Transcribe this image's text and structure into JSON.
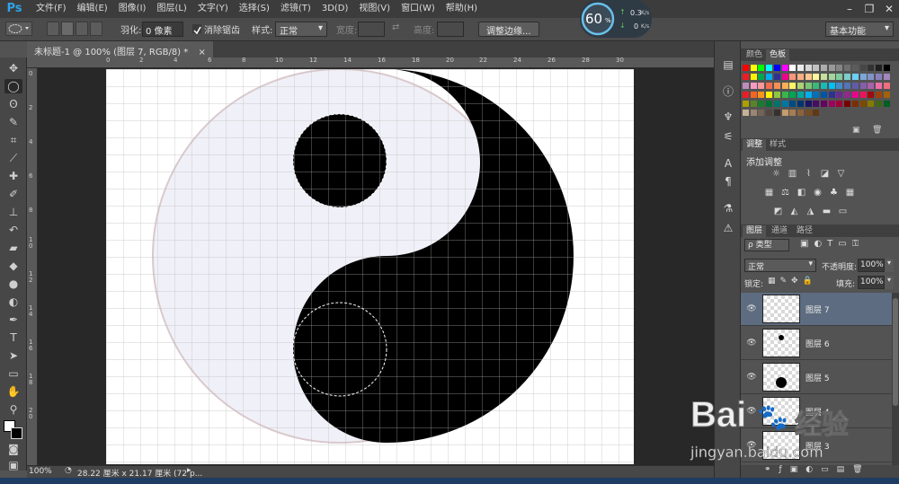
{
  "app": {
    "logo": "Ps",
    "menus": [
      "文件(F)",
      "编辑(E)",
      "图像(I)",
      "图层(L)",
      "文字(Y)",
      "选择(S)",
      "滤镜(T)",
      "3D(D)",
      "视图(V)",
      "窗口(W)",
      "帮助(H)"
    ]
  },
  "speed_widget": {
    "percent": "60",
    "unit": "%",
    "up": "0.3",
    "up_unit": "K/s",
    "down": "0",
    "down_unit": "K/s"
  },
  "options": {
    "feather_label": "羽化:",
    "feather_value": "0 像素",
    "antialias_label": "消除锯齿",
    "style_label": "样式:",
    "style_value": "正常",
    "width_label": "宽度:",
    "height_label": "高度:",
    "refine_edge_button": "调整边缘...",
    "workspace_value": "基本功能"
  },
  "document": {
    "tab_title": "未标题-1 @ 100% (图层 7, RGB/8) *",
    "tab_close": "×"
  },
  "rulers": {
    "top_ticks": [
      "0",
      "2",
      "4",
      "6",
      "8",
      "10",
      "12",
      "14",
      "16",
      "18",
      "20",
      "22",
      "24",
      "26",
      "28",
      "30"
    ],
    "left_ticks": [
      "0",
      "2",
      "4",
      "6",
      "8",
      "1\n0",
      "1\n2",
      "1\n4",
      "1\n6",
      "1\n8",
      "2\n0"
    ]
  },
  "status": {
    "zoom": "100%",
    "doc_info": "28.22 厘米 x 21.17 厘米 (72 p..."
  },
  "panels": {
    "color_tabs": [
      "颜色",
      "色板"
    ],
    "adjust_tabs": [
      "调整",
      "样式"
    ],
    "adjust_title": "添加调整",
    "layers_tabs": [
      "图层",
      "通道",
      "路径"
    ],
    "filter_kind": "ρ 类型",
    "blend_mode": "正常",
    "opacity_label": "不透明度:",
    "opacity_value": "100%",
    "lock_label": "锁定:",
    "fill_label": "填充:",
    "fill_value": "100%",
    "layers": [
      {
        "name": "图层 7",
        "selected": true
      },
      {
        "name": "图层 6",
        "selected": false
      },
      {
        "name": "图层 5",
        "selected": false
      },
      {
        "name": "图层 4",
        "selected": false
      },
      {
        "name": "图层 3",
        "selected": false
      }
    ]
  },
  "watermark": {
    "brand": "Bai",
    "brand2": "经验",
    "url": "jingyan.baidu.com"
  },
  "colors": {
    "accent": "#2fa3e6",
    "selected_layer": "#5d6c80",
    "canvas_bg": "#282828"
  }
}
